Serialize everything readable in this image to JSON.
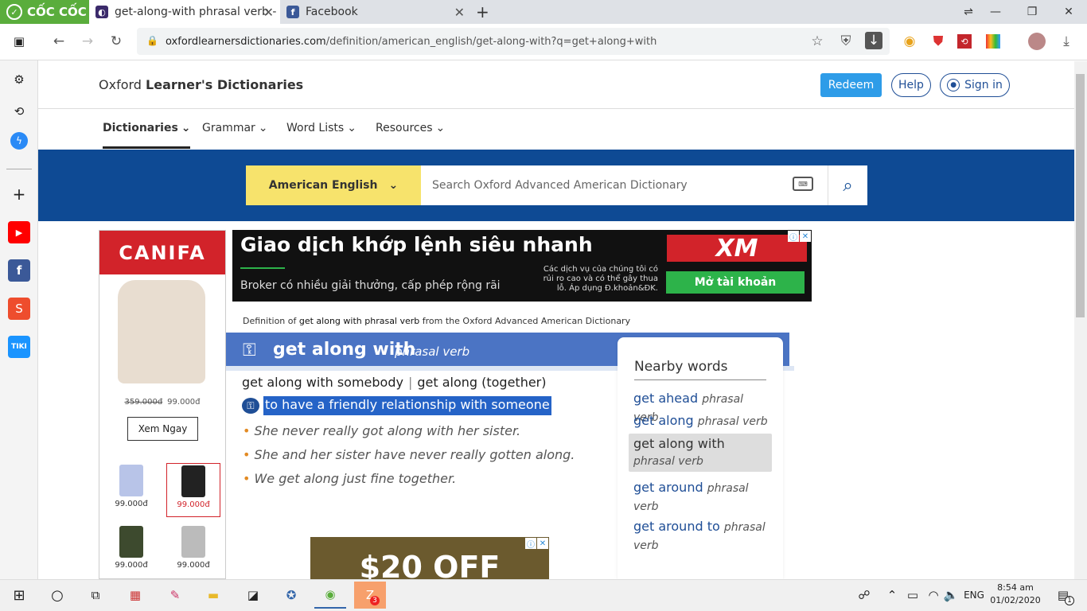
{
  "browser": {
    "brand": "CỐC CỐC",
    "tabs": [
      {
        "title": "get-along-with phrasal verb -"
      },
      {
        "title": "Facebook"
      }
    ],
    "url_domain": "oxfordlearnersdictionaries.com",
    "url_path": "/definition/american_english/get-along-with?q=get+along+with"
  },
  "site": {
    "brand_prefix": "Oxford ",
    "brand_bold": "Learner's Dictionaries",
    "redeem": "Redeem",
    "help": "Help",
    "signin": "Sign in",
    "nav": [
      "Dictionaries",
      "Grammar",
      "Word Lists",
      "Resources"
    ],
    "dictionary": "American English",
    "search_placeholder": "Search Oxford Advanced American Dictionary"
  },
  "ad_left": {
    "brand": "CANIFA",
    "old_price": "359.000đ",
    "price": "99.000đ",
    "cta": "Xem Ngay",
    "thumbs": [
      "99.000đ",
      "99.000đ",
      "99.000đ",
      "99.000đ"
    ]
  },
  "ad_top": {
    "headline": "Giao dịch khớp lệnh siêu nhanh",
    "sub": "Broker có nhiều giải thưởng, cấp phép rộng rãi",
    "note": "Các dịch vụ của chúng tôi có rủi ro cao và có thể gây thua lỗ. Áp dụng Đ.khoản&ĐK.",
    "brand": "XM",
    "cta": "Mở tài khoản"
  },
  "entry": {
    "def_of_prefix": "Definition of ",
    "def_of_word": "get along with phrasal verb",
    "def_of_suffix": " from the Oxford Advanced American Dictionary",
    "headword": "get along with",
    "pos": "phrasal verb",
    "cf1": "get along with somebody",
    "cf_sep": "|",
    "cf2": "get along (together)",
    "definition": "to have a friendly relationship with someone",
    "examples": [
      "She never really got along with her sister.",
      "She and her sister have never really gotten along.",
      "We get along just fine together."
    ]
  },
  "nearby": {
    "title": "Nearby words",
    "items": [
      {
        "word": "get ahead",
        "pos": "phrasal verb"
      },
      {
        "word": "get along",
        "pos": "phrasal verb"
      },
      {
        "word": "get along with",
        "pos": "phrasal verb"
      },
      {
        "word": "get around",
        "pos": "phrasal verb"
      },
      {
        "word": "get around to",
        "pos": "phrasal verb"
      }
    ]
  },
  "ad_bottom": {
    "text": "$20 OFF"
  },
  "taskbar": {
    "lang": "ENG",
    "time": "8:54 am",
    "date": "01/02/2020",
    "badge": "3",
    "notif": "1"
  }
}
